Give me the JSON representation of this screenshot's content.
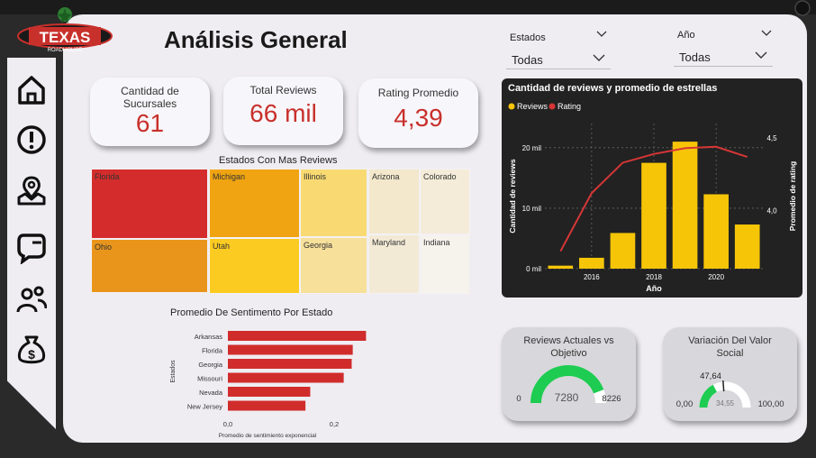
{
  "brand": {
    "logo_text": "TEXAS",
    "logo_sub": "ROADHOUSE"
  },
  "page_title": "Análisis General",
  "sidebar": [
    {
      "name": "home-icon"
    },
    {
      "name": "alert-icon"
    },
    {
      "name": "map-pin-icon"
    },
    {
      "name": "chat-bubble-icon"
    },
    {
      "name": "users-icon"
    },
    {
      "name": "money-bag-icon"
    }
  ],
  "filters": {
    "estados": {
      "label": "Estados",
      "value": "Todas"
    },
    "anio": {
      "label": "Año",
      "value": "Todas"
    }
  },
  "kpis": {
    "sucursales": {
      "label1": "Cantidad de",
      "label2": "Sucursales",
      "value": "61"
    },
    "reviews": {
      "label": "Total Reviews",
      "value": "66 mil"
    },
    "rating": {
      "label": "Rating Promedio",
      "value": "4,39"
    }
  },
  "treemap": {
    "title": "Estados Con Mas Reviews",
    "cells": [
      {
        "label": "Florida",
        "color": "#d42c2c"
      },
      {
        "label": "Ohio",
        "color": "#e9951c"
      },
      {
        "label": "Michigan",
        "color": "#f0a412"
      },
      {
        "label": "Utah",
        "color": "#fccb22"
      },
      {
        "label": "Illinois",
        "color": "#f9da72"
      },
      {
        "label": "Georgia",
        "color": "#f7e09a"
      },
      {
        "label": "Arizona",
        "color": "#f3e8cc"
      },
      {
        "label": "Maryland",
        "color": "#f3ead6"
      },
      {
        "label": "Colorado",
        "color": "#f4ecd8"
      },
      {
        "label": "Indiana",
        "color": "#f6f2ec"
      }
    ]
  },
  "sentiment": {
    "title": "Promedio De Sentimento Por Estado",
    "ylabel": "Estados",
    "xlabel": "Promedio de sentimiento exponencial",
    "ticks": [
      "0,0",
      "0,2"
    ],
    "states": [
      "Arkansas",
      "Florida",
      "Georgia",
      "Missouri",
      "Nevada",
      "New Jersey"
    ],
    "values": [
      0.26,
      0.235,
      0.233,
      0.218,
      0.155,
      0.146
    ],
    "xmax": 0.3,
    "color": "#d02c2c"
  },
  "chart_data": {
    "type": "bar",
    "title": "Cantidad de reviews y promedio de estrellas",
    "xlabel": "Año",
    "ylabel": "Cantidad de reviews",
    "y2label": "Promedio de rating",
    "legend": [
      "Reviews",
      "Rating"
    ],
    "categories": [
      "2015",
      "2016",
      "2017",
      "2018",
      "2019",
      "2020",
      "2021"
    ],
    "x_ticks": [
      "2016",
      "2018",
      "2020"
    ],
    "y_ticks": [
      "0 mil",
      "10 mil",
      "20 mil"
    ],
    "y2_ticks": [
      "4,0",
      "4,5"
    ],
    "ylim": [
      0,
      24000
    ],
    "y2lim": [
      3.6,
      4.6
    ],
    "series": [
      {
        "name": "Reviews",
        "type": "bar",
        "color": "#f6c508",
        "values": [
          500,
          1800,
          5900,
          17500,
          21000,
          12300,
          7300
        ]
      },
      {
        "name": "Rating",
        "type": "line",
        "color": "#d63636",
        "values": [
          3.72,
          4.12,
          4.33,
          4.39,
          4.43,
          4.44,
          4.37
        ]
      }
    ]
  },
  "gauges": {
    "reviews": {
      "title1": "Reviews Actuales vs",
      "title2": "Objetivo",
      "min": "0",
      "max": "8226",
      "value": "7280",
      "fraction": 0.885
    },
    "social": {
      "title1": "Variación Del Valor",
      "title2": "Social",
      "min": "0,00",
      "max": "100,00",
      "value": "34,55",
      "target": "47,64",
      "fraction": 0.3455,
      "target_fraction": 0.4764
    }
  }
}
